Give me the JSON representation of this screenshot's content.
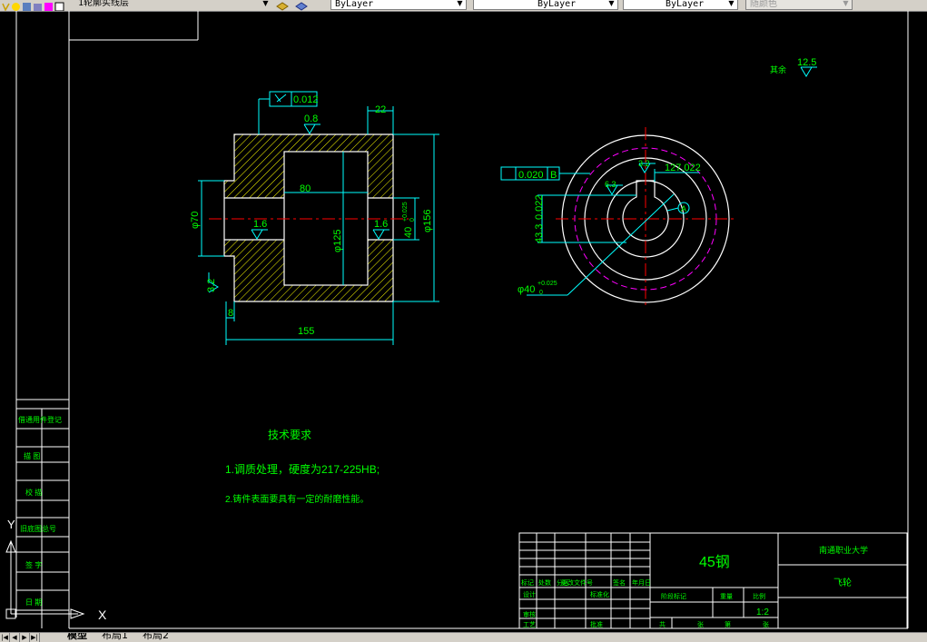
{
  "toolbar": {
    "layer_name": "1轮廓实线层",
    "color_control": "ByLayer",
    "linetype_control": "ByLayer",
    "lineweight_control": "ByLayer",
    "plotstyle_control": "随颜色"
  },
  "drawing": {
    "dims": {
      "flatness": "0.012",
      "rough_top": "0.8",
      "rough_bore": "1.6",
      "rough_right": "1.6",
      "rough_left": "3.2",
      "rough_key": "3.2",
      "rough_key2": "6.3",
      "rough_other": "12.5",
      "d22": "22",
      "d80": "80",
      "d155": "155",
      "d8": "8",
      "phi70": "φ70",
      "phi125": "φ125",
      "phi156": "φ156",
      "bore40": "40",
      "tol_upper": "+0.025",
      "tol_lower": "0",
      "runout": "0.020",
      "datum_b": "B",
      "key_width": "127.022",
      "key_depth": "43.3",
      "key_depth_tol": "0.022",
      "bore_phi": "φ40",
      "datum_a": "A",
      "other_label": "其余"
    },
    "notes": {
      "title": "技术要求",
      "line1": "1.调质处理，硬度为217-225HB;",
      "line2": "2.铸件表面要具有一定的耐磨性能。"
    },
    "side_panel": [
      "借通用件登记",
      "描 图",
      "校 描",
      "旧底图总号",
      "签 字",
      "日 期"
    ],
    "title_block": {
      "material": "45钢",
      "school": "南通职业大学",
      "part_name": "飞轮",
      "scale": "1:2",
      "scale_label": "比例",
      "weight_label": "重量",
      "stage_label": "阶段标记",
      "sheet_total": "共",
      "sheet_label": "张",
      "sheet_no": "第",
      "row_labels": [
        "标记",
        "处数",
        "分区",
        "更改文件号",
        "签名",
        "年月日"
      ],
      "row_design": "设计",
      "row_std": "标准化",
      "row_check": "审核",
      "row_process": "工艺",
      "row_approve": "批准"
    },
    "ucs": {
      "x": "X",
      "y": "Y"
    }
  },
  "tabs": [
    "模型",
    "布局1",
    "布局2"
  ],
  "colors": {
    "canvas": "#000000",
    "outline": "#ffffff",
    "dimension": "#00ffff",
    "text": "#00ff00",
    "centerline": "#ff0000",
    "hidden": "#ff00ff",
    "hatch": "#ffff00"
  }
}
